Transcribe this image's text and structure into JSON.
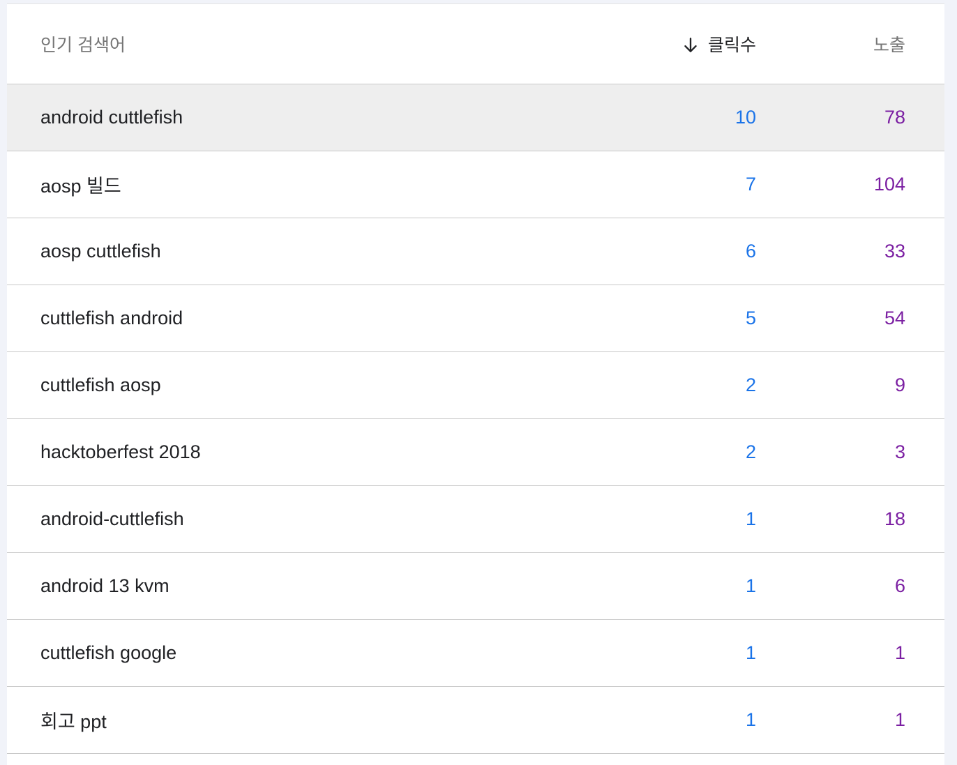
{
  "table": {
    "header": {
      "query_label": "인기 검색어",
      "clicks_label": "클릭수",
      "impressions_label": "노출",
      "sort_icon": "arrow-down-icon"
    },
    "colors": {
      "clicks": "#1a73e8",
      "impressions": "#7b1fa2",
      "selected_row_bg": "#eeeeee"
    },
    "rows": [
      {
        "query": "android cuttlefish",
        "clicks": "10",
        "impressions": "78",
        "selected": true
      },
      {
        "query": "aosp 빌드",
        "clicks": "7",
        "impressions": "104"
      },
      {
        "query": "aosp cuttlefish",
        "clicks": "6",
        "impressions": "33"
      },
      {
        "query": "cuttlefish android",
        "clicks": "5",
        "impressions": "54"
      },
      {
        "query": "cuttlefish aosp",
        "clicks": "2",
        "impressions": "9"
      },
      {
        "query": "hacktoberfest 2018",
        "clicks": "2",
        "impressions": "3"
      },
      {
        "query": "android-cuttlefish",
        "clicks": "1",
        "impressions": "18"
      },
      {
        "query": "android 13 kvm",
        "clicks": "1",
        "impressions": "6"
      },
      {
        "query": "cuttlefish google",
        "clicks": "1",
        "impressions": "1"
      },
      {
        "query": "회고 ppt",
        "clicks": "1",
        "impressions": "1"
      }
    ]
  }
}
